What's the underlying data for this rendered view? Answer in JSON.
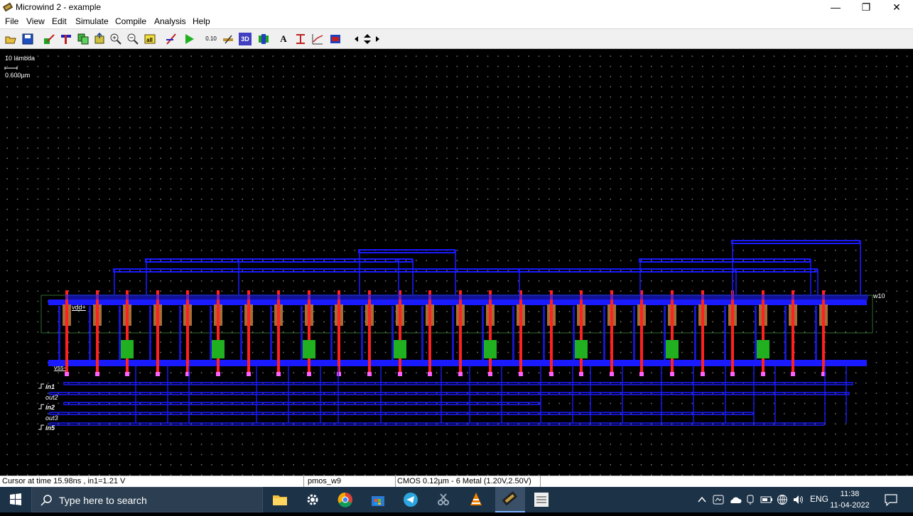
{
  "window": {
    "title": "Microwind 2 - example",
    "controls": [
      "—",
      "❐",
      "✕"
    ]
  },
  "menu": [
    "File",
    "View",
    "Edit",
    "Simulate",
    "Compile",
    "Analysis",
    "Help"
  ],
  "toolbar": {
    "text_tool": "A",
    "io_labels": [
      "0.10",
      "3D"
    ]
  },
  "canvas": {
    "scale_label": "10 lambda",
    "scale_value": "0.600µm",
    "vdd_label": "vdd+",
    "vss_label": "vss-",
    "right_label": "w10",
    "input_labels": [
      "in1",
      "out2",
      "in2",
      "out3",
      "in5"
    ]
  },
  "status": {
    "cursor": "Cursor at  time 15.98ns , in1=1.21 V",
    "layer": "pmos_w9",
    "tech": "CMOS 0.12µm - 6 Metal (1.20V,2.50V)"
  },
  "taskbar": {
    "search_placeholder": "Type here to search",
    "language": "ENG",
    "time": "11:38",
    "date": "11-04-2022"
  },
  "colors": {
    "metal1": "#1a1aff",
    "poly": "#ff2020",
    "diff_p": "#c08040",
    "diff_n": "#20b020",
    "nwell": "#2e6a2e"
  }
}
